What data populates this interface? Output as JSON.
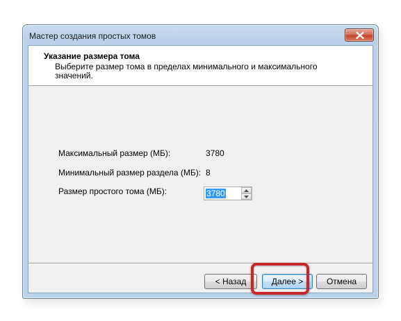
{
  "window": {
    "title": "Мастер создания простых томов",
    "close_icon": "close-icon"
  },
  "header": {
    "title": "Указание размера тома",
    "subtitle": "Выберите размер тома в пределах минимального и максимального значений."
  },
  "rows": {
    "max": {
      "label": "Максимальный размер (МБ):",
      "value": "3780"
    },
    "min": {
      "label": "Минимальный размер раздела (МБ):",
      "value": "8"
    },
    "size": {
      "label": "Размер простого тома (МБ):",
      "value": "3780"
    }
  },
  "buttons": {
    "back": "< Назад",
    "next": "Далее >",
    "cancel": "Отмена"
  },
  "colors": {
    "highlight": "#c9252c",
    "selection": "#3399ff"
  }
}
